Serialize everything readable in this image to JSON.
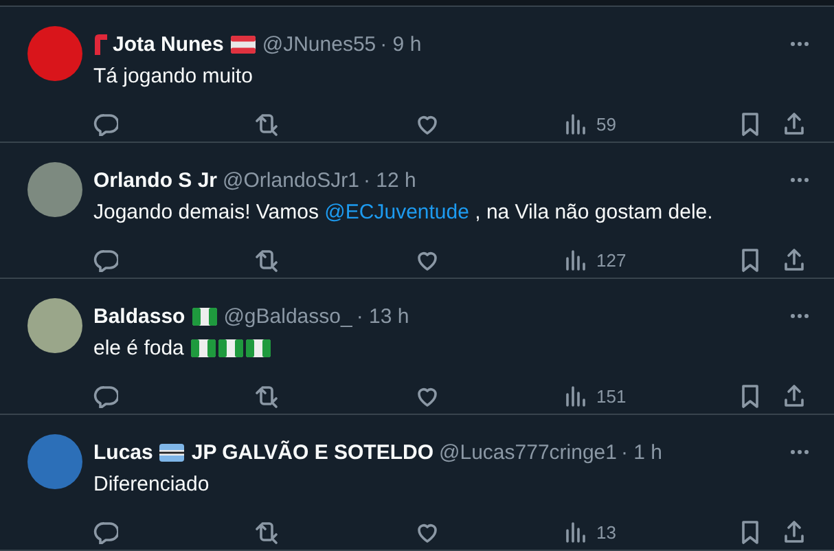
{
  "tweets": [
    {
      "avatar": {
        "color": "#d9151b"
      },
      "name_parts": [
        {
          "kind": "logo"
        },
        {
          "kind": "text",
          "text": "Jota Nunes"
        },
        {
          "kind": "flag_red_white_red"
        }
      ],
      "handle": "@JNunes55",
      "time": "· 9 h",
      "body": [
        {
          "kind": "text",
          "text": "Tá jogando muito"
        }
      ],
      "views": "59"
    },
    {
      "avatar": {
        "color": "#7d8a80"
      },
      "name_parts": [
        {
          "kind": "text",
          "text": "Orlando S Jr"
        }
      ],
      "handle": "@OrlandoSJr1",
      "time": "· 12 h",
      "body": [
        {
          "kind": "text",
          "text": "Jogando demais! Vamos "
        },
        {
          "kind": "mention",
          "text": "@ECJuventude"
        },
        {
          "kind": "text",
          "text": " , na Vila não gostam dele."
        }
      ],
      "views": "127"
    },
    {
      "avatar": {
        "color": "#9aa68a"
      },
      "name_parts": [
        {
          "kind": "text",
          "text": "Baldasso"
        },
        {
          "kind": "flag_green_white_green"
        }
      ],
      "handle": "@gBaldasso_",
      "time": "· 13 h",
      "body": [
        {
          "kind": "text",
          "text": "ele é foda"
        },
        {
          "kind": "flag_green_white_green"
        },
        {
          "kind": "flag_green_white_green"
        },
        {
          "kind": "flag_green_white_green"
        }
      ],
      "views": "151"
    },
    {
      "avatar": {
        "color": "#2c6fb8"
      },
      "name_parts": [
        {
          "kind": "text",
          "text": "Lucas"
        },
        {
          "kind": "flag_blue_white_blue"
        },
        {
          "kind": "text",
          "text": "JP GALVÃO E SOTELDO"
        }
      ],
      "handle": "@Lucas777cringe1",
      "time": "· 1 h",
      "body": [
        {
          "kind": "text",
          "text": "Diferenciado"
        }
      ],
      "views": "13"
    }
  ]
}
